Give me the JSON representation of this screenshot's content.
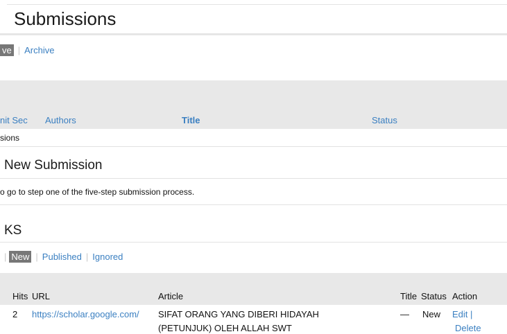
{
  "page": {
    "title": "Submissions"
  },
  "submission_tabs": {
    "active": "ve",
    "other": "Archive"
  },
  "submissions_table": {
    "headers": {
      "sec": "nit Sec",
      "authors": "Authors",
      "title": "Title",
      "status": "Status"
    },
    "empty_text": "sions"
  },
  "new_submission": {
    "heading": "New Submission",
    "text": "o go to step one of the five-step submission process."
  },
  "links_section": {
    "heading": "KS",
    "tabs": {
      "active": "New",
      "published": "Published",
      "ignored": "Ignored"
    },
    "headers": {
      "hits": "Hits",
      "url": "URL",
      "article": "Article",
      "title": "Title",
      "status": "Status",
      "action": "Action"
    },
    "rows": [
      {
        "hits": "2",
        "url": "https://scholar.google.com/",
        "article_line1": "SIFAT ORANG YANG DIBERI HIDAYAH",
        "article_line2": "(PETUNJUK) OLEH ALLAH SWT",
        "title": "—",
        "status": "New",
        "edit": "Edit",
        "delete": "Delete"
      }
    ]
  }
}
